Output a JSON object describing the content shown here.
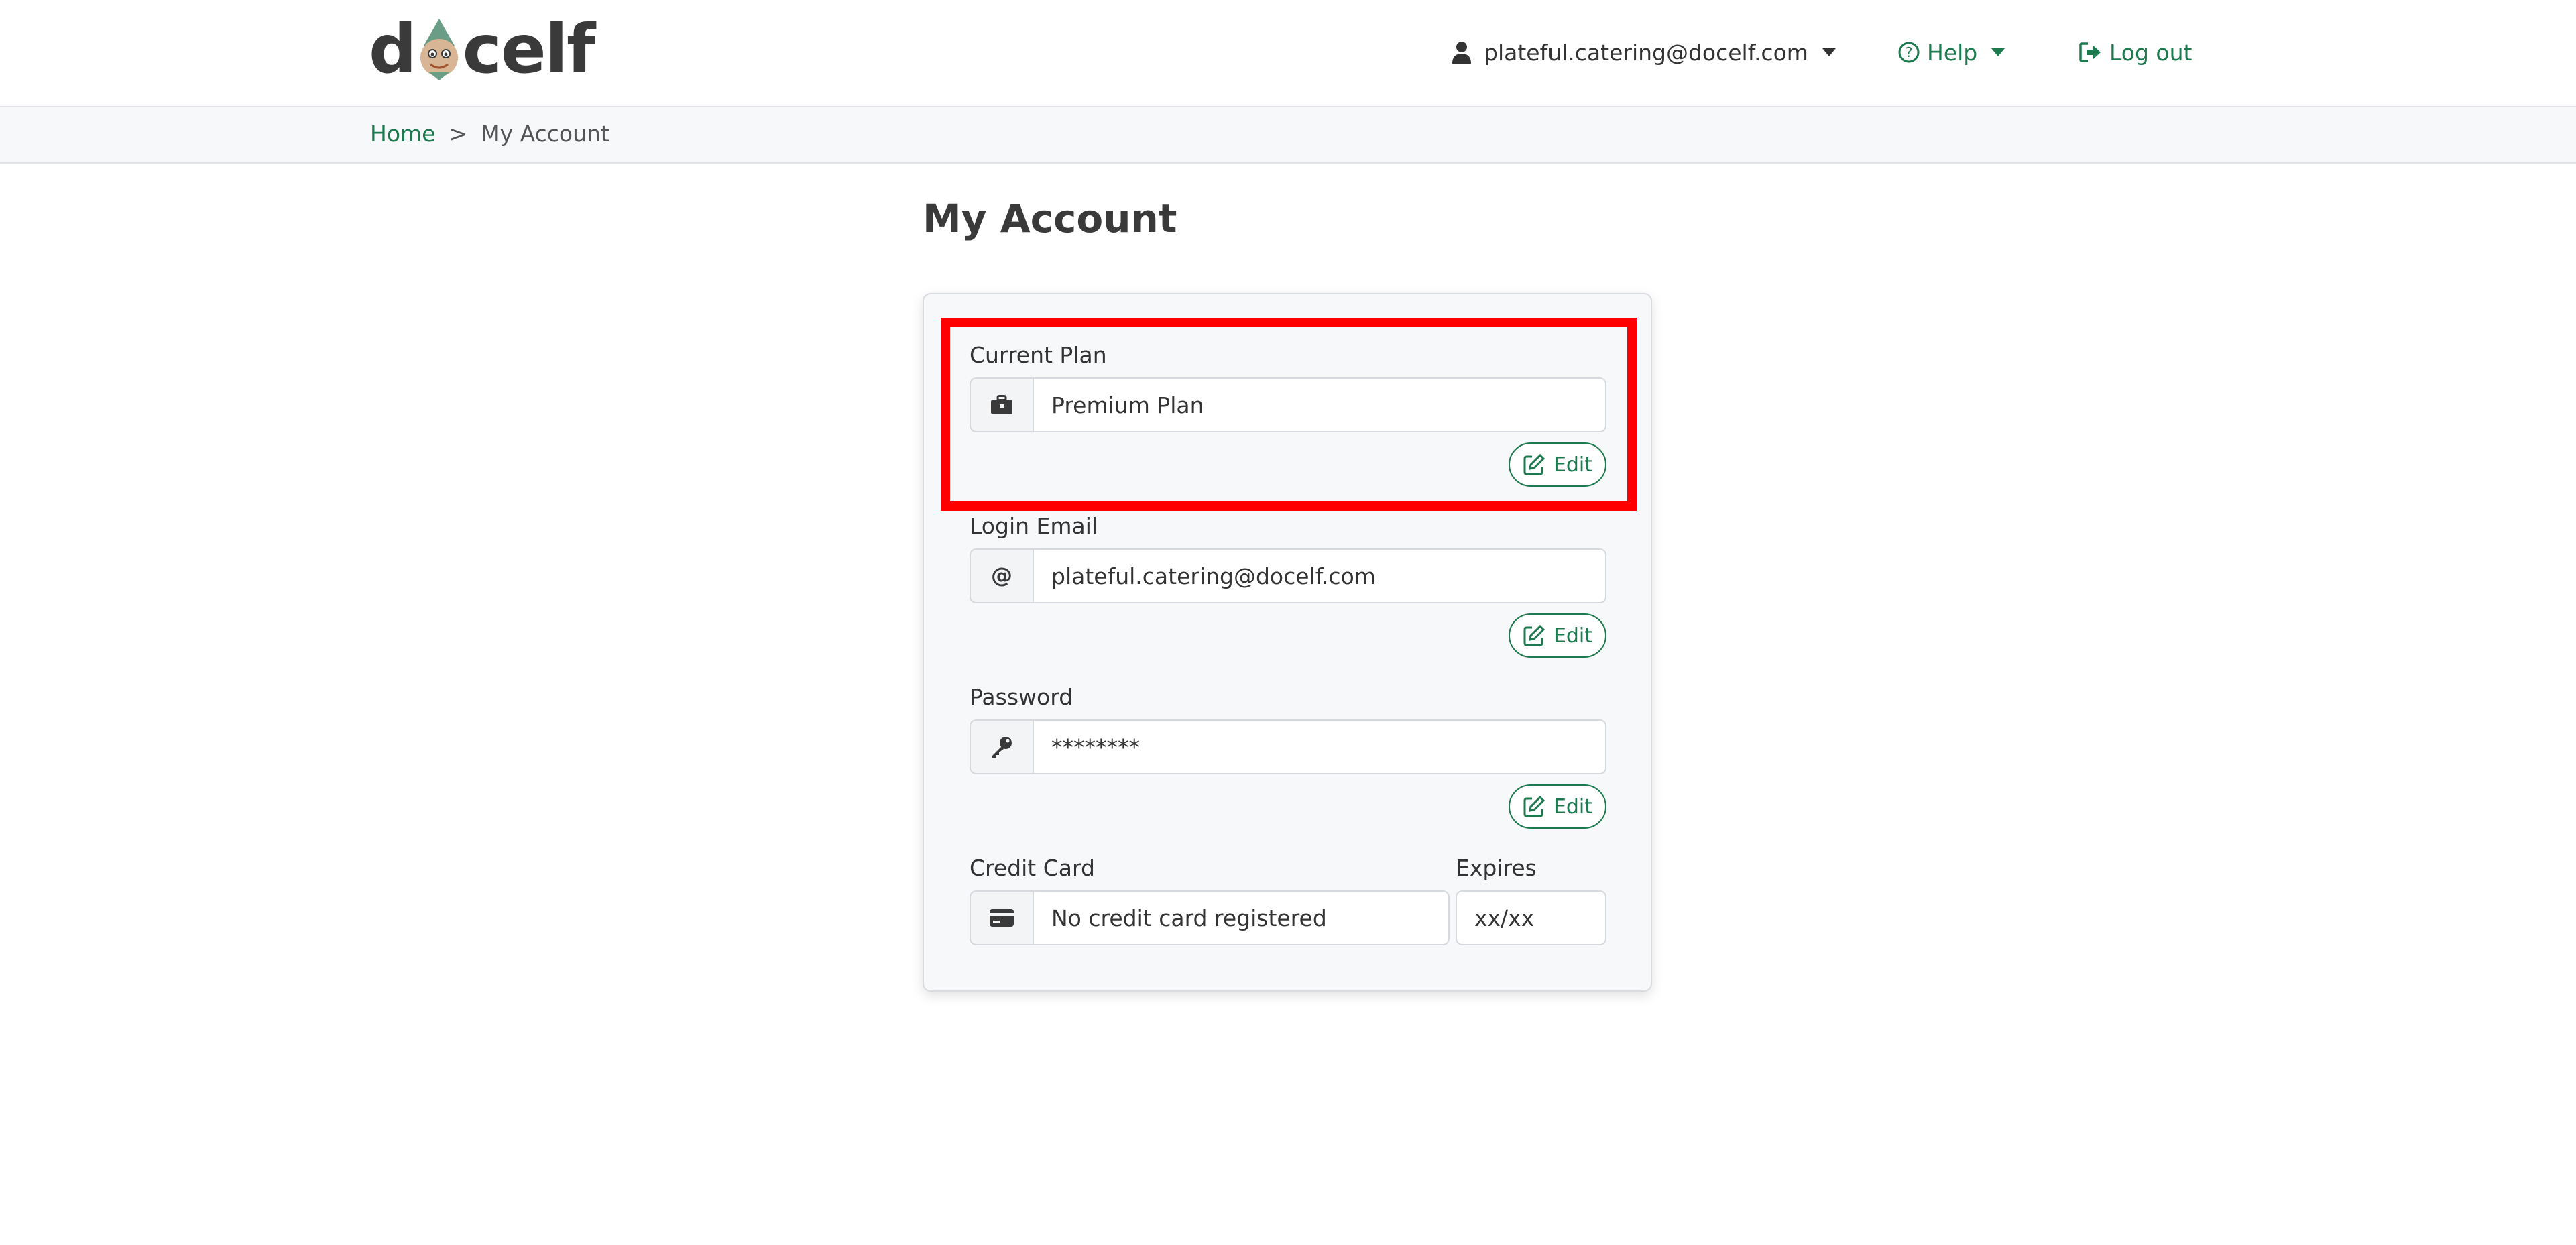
{
  "brand": {
    "logo_text": "docelf",
    "logo_left": "d",
    "logo_right": "celf"
  },
  "nav": {
    "user_email": "plateful.catering@docelf.com",
    "help_label": "Help",
    "logout_label": "Log out"
  },
  "breadcrumb": {
    "home": "Home",
    "separator": ">",
    "current": "My Account"
  },
  "page": {
    "title": "My Account"
  },
  "account": {
    "plan": {
      "label": "Current Plan",
      "value": "Premium Plan",
      "edit": "Edit",
      "icon": "briefcase-icon"
    },
    "email": {
      "label": "Login Email",
      "value": "plateful.catering@docelf.com",
      "edit": "Edit",
      "icon": "at-icon"
    },
    "password": {
      "label": "Password",
      "value": "********",
      "edit": "Edit",
      "icon": "key-icon"
    },
    "card": {
      "label": "Credit Card",
      "value": "No credit card registered",
      "icon": "credit-card-icon"
    },
    "expires": {
      "label": "Expires",
      "value": "xx/xx"
    }
  },
  "colors": {
    "accent": "#1d7a4e",
    "highlight": "#ff0000",
    "text": "#3a3a3a",
    "subtle_bg": "#f7f8fa"
  }
}
